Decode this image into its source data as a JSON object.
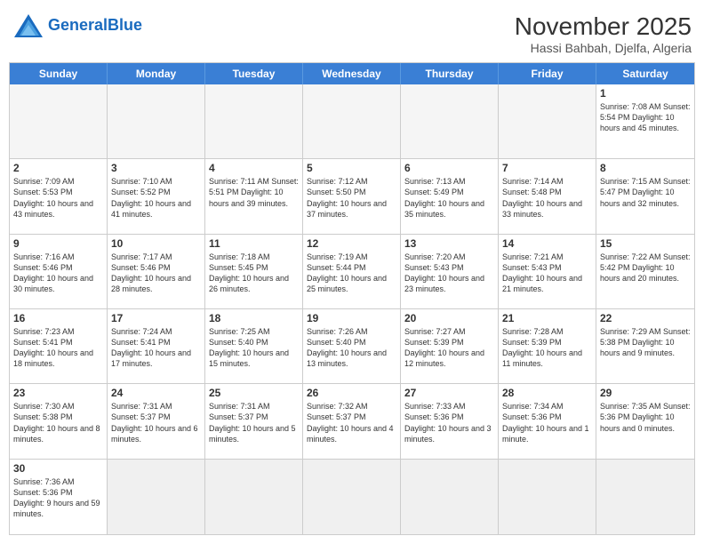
{
  "header": {
    "logo_general": "General",
    "logo_blue": "Blue",
    "month_title": "November 2025",
    "location": "Hassi Bahbah, Djelfa, Algeria"
  },
  "day_headers": [
    "Sunday",
    "Monday",
    "Tuesday",
    "Wednesday",
    "Thursday",
    "Friday",
    "Saturday"
  ],
  "weeks": [
    [
      {
        "day": "",
        "info": ""
      },
      {
        "day": "",
        "info": ""
      },
      {
        "day": "",
        "info": ""
      },
      {
        "day": "",
        "info": ""
      },
      {
        "day": "",
        "info": ""
      },
      {
        "day": "",
        "info": ""
      },
      {
        "day": "1",
        "info": "Sunrise: 7:08 AM\nSunset: 5:54 PM\nDaylight: 10 hours and 45 minutes."
      }
    ],
    [
      {
        "day": "2",
        "info": "Sunrise: 7:09 AM\nSunset: 5:53 PM\nDaylight: 10 hours and 43 minutes."
      },
      {
        "day": "3",
        "info": "Sunrise: 7:10 AM\nSunset: 5:52 PM\nDaylight: 10 hours and 41 minutes."
      },
      {
        "day": "4",
        "info": "Sunrise: 7:11 AM\nSunset: 5:51 PM\nDaylight: 10 hours and 39 minutes."
      },
      {
        "day": "5",
        "info": "Sunrise: 7:12 AM\nSunset: 5:50 PM\nDaylight: 10 hours and 37 minutes."
      },
      {
        "day": "6",
        "info": "Sunrise: 7:13 AM\nSunset: 5:49 PM\nDaylight: 10 hours and 35 minutes."
      },
      {
        "day": "7",
        "info": "Sunrise: 7:14 AM\nSunset: 5:48 PM\nDaylight: 10 hours and 33 minutes."
      },
      {
        "day": "8",
        "info": "Sunrise: 7:15 AM\nSunset: 5:47 PM\nDaylight: 10 hours and 32 minutes."
      }
    ],
    [
      {
        "day": "9",
        "info": "Sunrise: 7:16 AM\nSunset: 5:46 PM\nDaylight: 10 hours and 30 minutes."
      },
      {
        "day": "10",
        "info": "Sunrise: 7:17 AM\nSunset: 5:46 PM\nDaylight: 10 hours and 28 minutes."
      },
      {
        "day": "11",
        "info": "Sunrise: 7:18 AM\nSunset: 5:45 PM\nDaylight: 10 hours and 26 minutes."
      },
      {
        "day": "12",
        "info": "Sunrise: 7:19 AM\nSunset: 5:44 PM\nDaylight: 10 hours and 25 minutes."
      },
      {
        "day": "13",
        "info": "Sunrise: 7:20 AM\nSunset: 5:43 PM\nDaylight: 10 hours and 23 minutes."
      },
      {
        "day": "14",
        "info": "Sunrise: 7:21 AM\nSunset: 5:43 PM\nDaylight: 10 hours and 21 minutes."
      },
      {
        "day": "15",
        "info": "Sunrise: 7:22 AM\nSunset: 5:42 PM\nDaylight: 10 hours and 20 minutes."
      }
    ],
    [
      {
        "day": "16",
        "info": "Sunrise: 7:23 AM\nSunset: 5:41 PM\nDaylight: 10 hours and 18 minutes."
      },
      {
        "day": "17",
        "info": "Sunrise: 7:24 AM\nSunset: 5:41 PM\nDaylight: 10 hours and 17 minutes."
      },
      {
        "day": "18",
        "info": "Sunrise: 7:25 AM\nSunset: 5:40 PM\nDaylight: 10 hours and 15 minutes."
      },
      {
        "day": "19",
        "info": "Sunrise: 7:26 AM\nSunset: 5:40 PM\nDaylight: 10 hours and 13 minutes."
      },
      {
        "day": "20",
        "info": "Sunrise: 7:27 AM\nSunset: 5:39 PM\nDaylight: 10 hours and 12 minutes."
      },
      {
        "day": "21",
        "info": "Sunrise: 7:28 AM\nSunset: 5:39 PM\nDaylight: 10 hours and 11 minutes."
      },
      {
        "day": "22",
        "info": "Sunrise: 7:29 AM\nSunset: 5:38 PM\nDaylight: 10 hours and 9 minutes."
      }
    ],
    [
      {
        "day": "23",
        "info": "Sunrise: 7:30 AM\nSunset: 5:38 PM\nDaylight: 10 hours and 8 minutes."
      },
      {
        "day": "24",
        "info": "Sunrise: 7:31 AM\nSunset: 5:37 PM\nDaylight: 10 hours and 6 minutes."
      },
      {
        "day": "25",
        "info": "Sunrise: 7:31 AM\nSunset: 5:37 PM\nDaylight: 10 hours and 5 minutes."
      },
      {
        "day": "26",
        "info": "Sunrise: 7:32 AM\nSunset: 5:37 PM\nDaylight: 10 hours and 4 minutes."
      },
      {
        "day": "27",
        "info": "Sunrise: 7:33 AM\nSunset: 5:36 PM\nDaylight: 10 hours and 3 minutes."
      },
      {
        "day": "28",
        "info": "Sunrise: 7:34 AM\nSunset: 5:36 PM\nDaylight: 10 hours and 1 minute."
      },
      {
        "day": "29",
        "info": "Sunrise: 7:35 AM\nSunset: 5:36 PM\nDaylight: 10 hours and 0 minutes."
      }
    ],
    [
      {
        "day": "30",
        "info": "Sunrise: 7:36 AM\nSunset: 5:36 PM\nDaylight: 9 hours and 59 minutes."
      },
      {
        "day": "",
        "info": ""
      },
      {
        "day": "",
        "info": ""
      },
      {
        "day": "",
        "info": ""
      },
      {
        "day": "",
        "info": ""
      },
      {
        "day": "",
        "info": ""
      },
      {
        "day": "",
        "info": ""
      }
    ]
  ]
}
